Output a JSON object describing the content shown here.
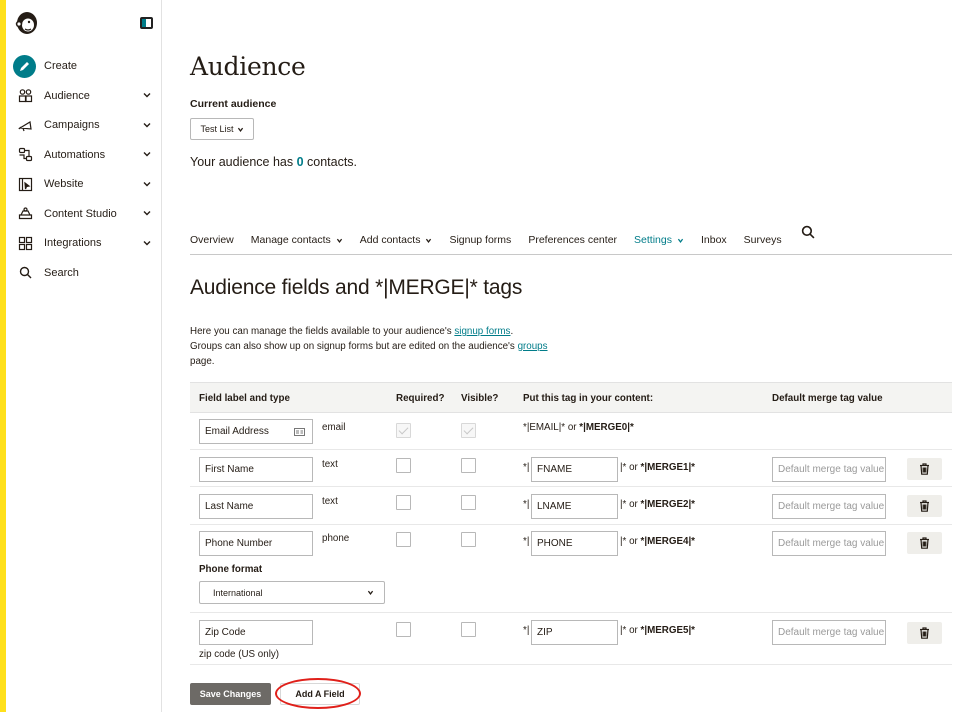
{
  "sidebar": {
    "items": [
      {
        "label": "Create",
        "icon": "pencil-icon",
        "has_chevron": false
      },
      {
        "label": "Audience",
        "icon": "audience-icon",
        "has_chevron": true
      },
      {
        "label": "Campaigns",
        "icon": "megaphone-icon",
        "has_chevron": true
      },
      {
        "label": "Automations",
        "icon": "automations-icon",
        "has_chevron": true
      },
      {
        "label": "Website",
        "icon": "website-icon",
        "has_chevron": true
      },
      {
        "label": "Content Studio",
        "icon": "content-studio-icon",
        "has_chevron": true
      },
      {
        "label": "Integrations",
        "icon": "integrations-icon",
        "has_chevron": true
      },
      {
        "label": "Search",
        "icon": "search-icon",
        "has_chevron": false
      }
    ]
  },
  "header": {
    "title": "Audience",
    "current_audience_label": "Current audience",
    "current_audience_value": "Test List",
    "count_prefix": "Your audience has ",
    "count_value": "0",
    "count_suffix": " contacts."
  },
  "tabs": [
    {
      "label": "Overview",
      "dropdown": false,
      "active": false
    },
    {
      "label": "Manage contacts",
      "dropdown": true,
      "active": false
    },
    {
      "label": "Add contacts",
      "dropdown": true,
      "active": false
    },
    {
      "label": "Signup forms",
      "dropdown": false,
      "active": false
    },
    {
      "label": "Preferences center",
      "dropdown": false,
      "active": false
    },
    {
      "label": "Settings",
      "dropdown": true,
      "active": true
    },
    {
      "label": "Inbox",
      "dropdown": false,
      "active": false
    },
    {
      "label": "Surveys",
      "dropdown": false,
      "active": false
    }
  ],
  "section": {
    "title": "Audience fields and *|MERGE|* tags",
    "intro_1": "Here you can manage the fields available to your audience's ",
    "intro_link_1": "signup forms",
    "intro_2": ".",
    "intro_3": "Groups can also show up on signup forms but are edited on the audience's ",
    "intro_link_2": "groups",
    "intro_4": "page."
  },
  "table": {
    "headers": {
      "field": "Field label and type",
      "required": "Required?",
      "visible": "Visible?",
      "tag": "Put this tag in your content:",
      "default": "Default merge tag value"
    },
    "email_row": {
      "label": "Email Address",
      "type": "email",
      "tag_text": "*|EMAIL|* or ",
      "tag_bold": "*|MERGE0|*"
    },
    "rows": [
      {
        "label": "First Name",
        "type": "text",
        "tag": "FNAME",
        "merge": "*|MERGE1|*",
        "default_placeholder": "Default merge tag value"
      },
      {
        "label": "Last Name",
        "type": "text",
        "tag": "LNAME",
        "merge": "*|MERGE2|*",
        "default_placeholder": "Default merge tag value"
      },
      {
        "label": "Phone Number",
        "type": "phone",
        "tag": "PHONE",
        "merge": "*|MERGE4|*",
        "default_placeholder": "Default merge tag value"
      },
      {
        "label": "Zip Code",
        "type": "",
        "tag": "ZIP",
        "merge": "*|MERGE5|*",
        "default_placeholder": "Default merge tag value"
      }
    ],
    "tag_prefix": "*|",
    "tag_suffix": "|* or ",
    "phone_format_label": "Phone format",
    "phone_format_value": "International",
    "zip_help": "zip code (US only)"
  },
  "actions": {
    "save_label": "Save Changes",
    "add_field_label": "Add A Field"
  },
  "colors": {
    "accent": "#007c89",
    "highlight": "#e0201a",
    "brand_bar": "#ffe01b"
  }
}
